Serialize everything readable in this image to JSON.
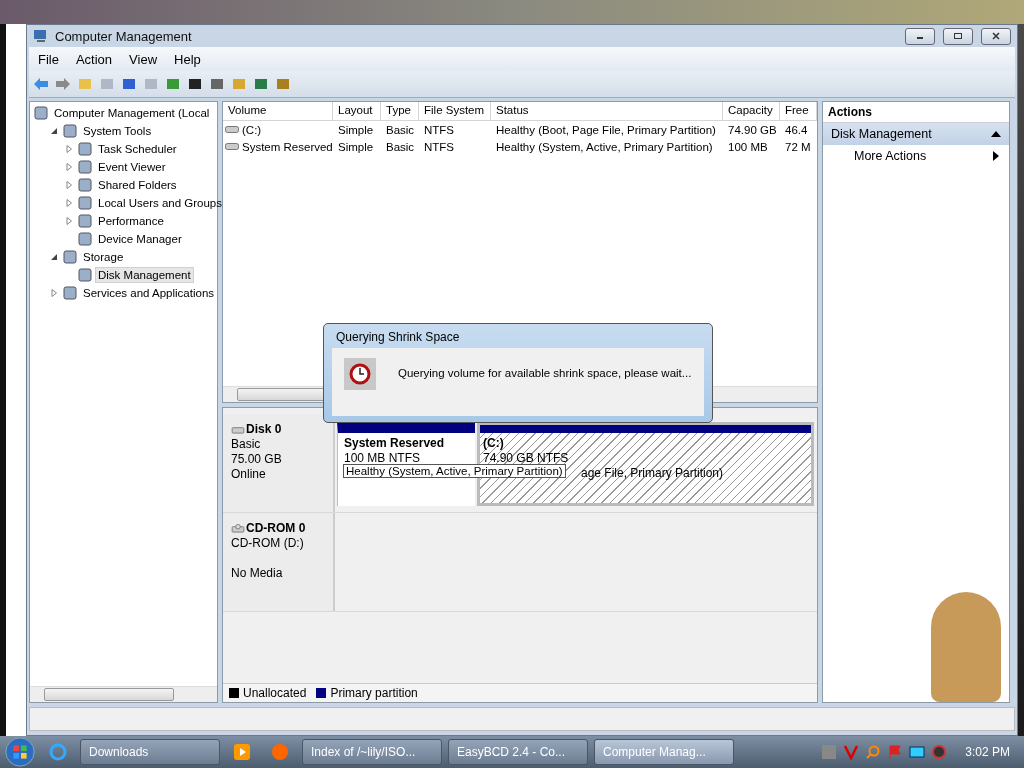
{
  "window": {
    "title": "Computer Management"
  },
  "menu": [
    "File",
    "Action",
    "View",
    "Help"
  ],
  "tree": [
    {
      "label": "Computer Management (Local",
      "selected": false,
      "children": [
        {
          "label": "System Tools",
          "expanded": true,
          "selected": false,
          "children": [
            {
              "label": "Task Scheduler",
              "expanded": false,
              "selected": false
            },
            {
              "label": "Event Viewer",
              "expanded": false,
              "selected": false
            },
            {
              "label": "Shared Folders",
              "expanded": false,
              "selected": false
            },
            {
              "label": "Local Users and Groups",
              "expanded": false,
              "selected": false
            },
            {
              "label": "Performance",
              "expanded": false,
              "selected": false
            },
            {
              "label": "Device Manager",
              "selected": false
            }
          ]
        },
        {
          "label": "Storage",
          "expanded": true,
          "selected": false,
          "children": [
            {
              "label": "Disk Management",
              "selected": true
            }
          ]
        },
        {
          "label": "Services and Applications",
          "expanded": false,
          "selected": false
        }
      ]
    }
  ],
  "volumes": {
    "columns": [
      "Volume",
      "Layout",
      "Type",
      "File System",
      "Status",
      "Capacity",
      "Free"
    ],
    "rows": [
      [
        "(C:)",
        "Simple",
        "Basic",
        "NTFS",
        "Healthy (Boot, Page File, Primary Partition)",
        "74.90 GB",
        "46.4"
      ],
      [
        "System Reserved",
        "Simple",
        "Basic",
        "NTFS",
        "Healthy (System, Active, Primary Partition)",
        "100 MB",
        "72 M"
      ]
    ]
  },
  "disks": [
    {
      "name": "Disk 0",
      "kind": "disk",
      "lines": [
        "Basic",
        "75.00 GB",
        "Online"
      ],
      "partitions": [
        {
          "name": "System Reserved",
          "detail": "100 MB NTFS",
          "selected": false
        },
        {
          "name": "(C:)",
          "detail": "74.90 GB NTFS",
          "status": "age File, Primary Partition)",
          "selected": true
        }
      ]
    },
    {
      "name": "CD-ROM 0",
      "kind": "cdrom",
      "lines": [
        "CD-ROM (D:)",
        "No Media"
      ]
    }
  ],
  "tooltip": "Healthy (System, Active, Primary Partition)",
  "legend": [
    {
      "label": "Unallocated",
      "color": "#000000"
    },
    {
      "label": "Primary partition",
      "color": "#000080"
    }
  ],
  "actions": {
    "title": "Actions",
    "section": "Disk Management",
    "items": [
      "More Actions"
    ]
  },
  "dialog": {
    "title": "Querying Shrink Space",
    "message": "Querying volume for available shrink space, please wait..."
  },
  "taskbar": [
    {
      "label": "Downloads",
      "selected": false
    },
    {
      "label": "Index of /~lily/ISO...",
      "selected": false
    },
    {
      "label": "EasyBCD 2.4 - Co...",
      "selected": false
    },
    {
      "label": "Computer Manag...",
      "selected": true
    }
  ],
  "clock": "3:02 PM"
}
